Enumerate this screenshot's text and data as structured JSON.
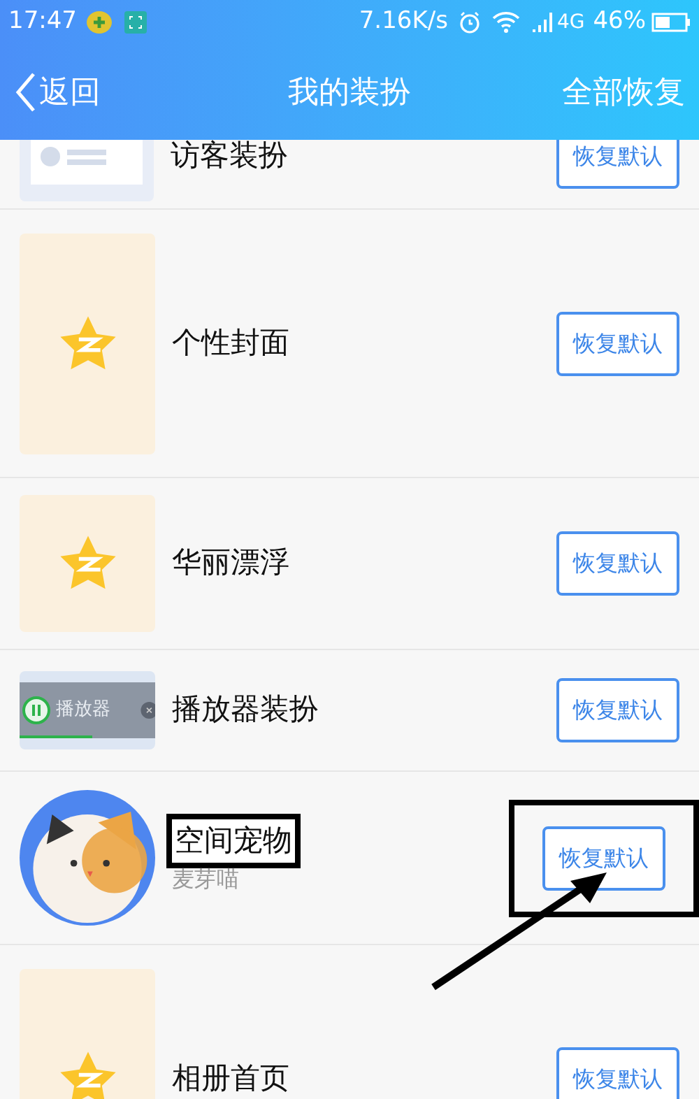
{
  "status_bar": {
    "time": "17:47",
    "speed": "7.16K/s",
    "network": "4G",
    "battery": "46%"
  },
  "nav": {
    "back": "返回",
    "title": "我的装扮",
    "action": "全部恢复"
  },
  "rows": [
    {
      "kind": "visitor",
      "title": "访客装扮",
      "button": "恢复默认",
      "highlighted": false
    },
    {
      "kind": "cover",
      "title": "个性封面",
      "button": "恢复默认",
      "highlighted": false
    },
    {
      "kind": "star",
      "title": "华丽漂浮",
      "button": "恢复默认",
      "highlighted": false
    },
    {
      "kind": "player",
      "title": "播放器装扮",
      "thumb_text": "播放器",
      "button": "恢复默认",
      "highlighted": false
    },
    {
      "kind": "pet",
      "title": "空间宠物",
      "subtitle": "麦芽喵",
      "button": "恢复默认",
      "highlighted": true
    },
    {
      "kind": "cover",
      "title": "相册首页",
      "button": "恢复默认",
      "highlighted": false
    }
  ]
}
